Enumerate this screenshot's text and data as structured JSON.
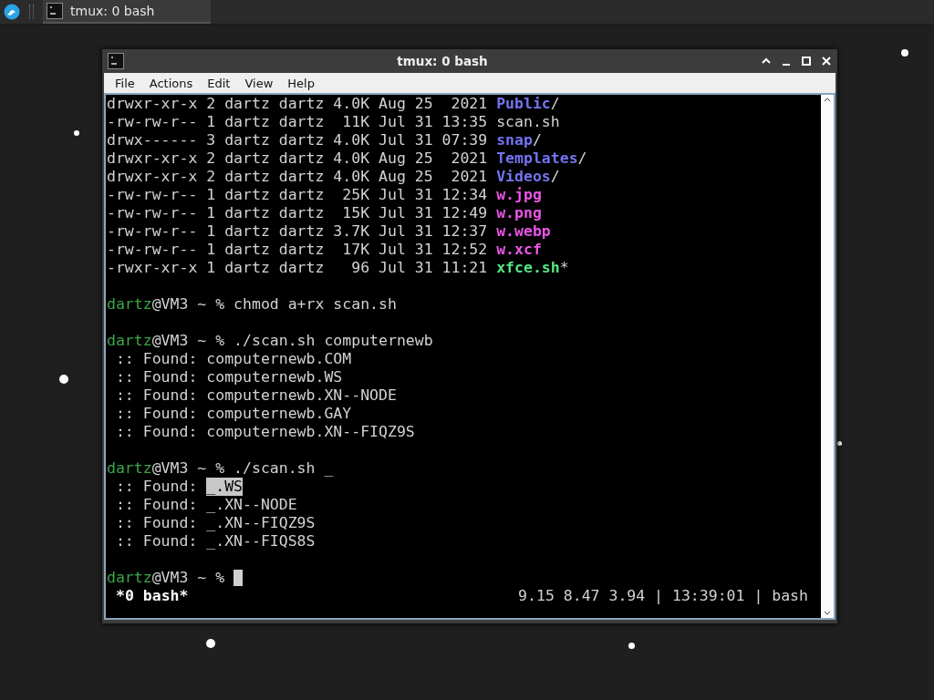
{
  "taskbar": {
    "task": {
      "title": "tmux: 0 bash",
      "selected": true
    }
  },
  "window": {
    "title": "tmux: 0 bash"
  },
  "menu": [
    "File",
    "Actions",
    "Edit",
    "View",
    "Help"
  ],
  "terminal": {
    "lines": [
      {
        "segments": [
          {
            "kind": "plain",
            "text": "drwxr-xr-x 2 dartz dartz 4.0K Aug 25  2021 "
          },
          {
            "kind": "dir",
            "text": "Public"
          },
          {
            "kind": "plain",
            "text": "/"
          }
        ]
      },
      {
        "segments": [
          {
            "kind": "plain",
            "text": "-rw-rw-r-- 1 dartz dartz  11K Jul 31 13:35 scan.sh"
          }
        ]
      },
      {
        "segments": [
          {
            "kind": "plain",
            "text": "drwx------ 3 dartz dartz 4.0K Jul 31 07:39 "
          },
          {
            "kind": "dir",
            "text": "snap"
          },
          {
            "kind": "plain",
            "text": "/"
          }
        ]
      },
      {
        "segments": [
          {
            "kind": "plain",
            "text": "drwxr-xr-x 2 dartz dartz 4.0K Aug 25  2021 "
          },
          {
            "kind": "dir",
            "text": "Templates"
          },
          {
            "kind": "plain",
            "text": "/"
          }
        ]
      },
      {
        "segments": [
          {
            "kind": "plain",
            "text": "drwxr-xr-x 2 dartz dartz 4.0K Aug 25  2021 "
          },
          {
            "kind": "dir",
            "text": "Videos"
          },
          {
            "kind": "plain",
            "text": "/"
          }
        ]
      },
      {
        "segments": [
          {
            "kind": "plain",
            "text": "-rw-rw-r-- 1 dartz dartz  25K Jul 31 12:34 "
          },
          {
            "kind": "image",
            "text": "w.jpg"
          }
        ]
      },
      {
        "segments": [
          {
            "kind": "plain",
            "text": "-rw-rw-r-- 1 dartz dartz  15K Jul 31 12:49 "
          },
          {
            "kind": "image",
            "text": "w.png"
          }
        ]
      },
      {
        "segments": [
          {
            "kind": "plain",
            "text": "-rw-rw-r-- 1 dartz dartz 3.7K Jul 31 12:37 "
          },
          {
            "kind": "image",
            "text": "w.webp"
          }
        ]
      },
      {
        "segments": [
          {
            "kind": "plain",
            "text": "-rw-rw-r-- 1 dartz dartz  17K Jul 31 12:52 "
          },
          {
            "kind": "image",
            "text": "w.xcf"
          }
        ]
      },
      {
        "segments": [
          {
            "kind": "plain",
            "text": "-rwxr-xr-x 1 dartz dartz   96 Jul 31 11:21 "
          },
          {
            "kind": "exec",
            "text": "xfce.sh"
          },
          {
            "kind": "plain",
            "text": "*"
          }
        ]
      },
      {
        "kind": "blank"
      },
      {
        "segments": [
          {
            "kind": "user",
            "text": "dartz"
          },
          {
            "kind": "plain",
            "text": "@VM3 ~ % chmod a+rx scan.sh"
          }
        ]
      },
      {
        "kind": "blank"
      },
      {
        "segments": [
          {
            "kind": "user",
            "text": "dartz"
          },
          {
            "kind": "plain",
            "text": "@VM3 ~ % ./scan.sh computernewb"
          }
        ]
      },
      {
        "segments": [
          {
            "kind": "plain",
            "text": " :: Found: computernewb.COM"
          }
        ]
      },
      {
        "segments": [
          {
            "kind": "plain",
            "text": " :: Found: computernewb.WS"
          }
        ]
      },
      {
        "segments": [
          {
            "kind": "plain",
            "text": " :: Found: computernewb.XN--NODE"
          }
        ]
      },
      {
        "segments": [
          {
            "kind": "plain",
            "text": " :: Found: computernewb.GAY"
          }
        ]
      },
      {
        "segments": [
          {
            "kind": "plain",
            "text": " :: Found: computernewb.XN--FIQZ9S"
          }
        ]
      },
      {
        "kind": "blank"
      },
      {
        "segments": [
          {
            "kind": "user",
            "text": "dartz"
          },
          {
            "kind": "plain",
            "text": "@VM3 ~ % ./scan.sh _"
          }
        ]
      },
      {
        "segments": [
          {
            "kind": "plain",
            "text": " :: Found: "
          },
          {
            "kind": "selected",
            "text": "_.WS"
          }
        ]
      },
      {
        "segments": [
          {
            "kind": "plain",
            "text": " :: Found: _.XN--NODE"
          }
        ]
      },
      {
        "segments": [
          {
            "kind": "plain",
            "text": " :: Found: _.XN--FIQZ9S"
          }
        ]
      },
      {
        "segments": [
          {
            "kind": "plain",
            "text": " :: Found: _.XN--FIQS8S"
          }
        ]
      },
      {
        "kind": "blank"
      },
      {
        "segments": [
          {
            "kind": "user",
            "text": "dartz"
          },
          {
            "kind": "plain",
            "text": "@VM3 ~ % "
          }
        ],
        "cursor": true
      }
    ],
    "status": {
      "left": "*0 bash*",
      "right": "9.15 8.47 3.94 | 13:39:01 | bash"
    }
  }
}
